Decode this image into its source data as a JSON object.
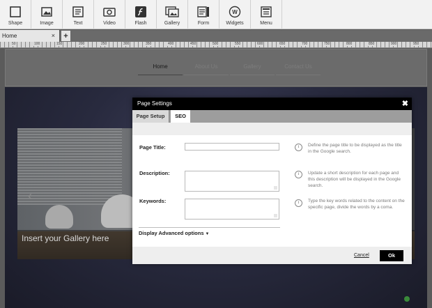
{
  "toolbar": {
    "items": [
      {
        "label": "Shape",
        "icon": "square-icon"
      },
      {
        "label": "Image",
        "icon": "image-icon"
      },
      {
        "label": "Text",
        "icon": "text-icon"
      },
      {
        "label": "Video",
        "icon": "video-icon"
      },
      {
        "label": "Flash",
        "icon": "flash-icon"
      },
      {
        "label": "Gallery",
        "icon": "gallery-icon"
      },
      {
        "label": "Form",
        "icon": "form-icon"
      },
      {
        "label": "Widgets",
        "icon": "widgets-icon"
      },
      {
        "label": "Menu",
        "icon": "menu-icon"
      }
    ]
  },
  "tabs": {
    "active": "Home",
    "close_glyph": "×",
    "add_glyph": "+"
  },
  "ruler": {
    "ticks": [
      "50",
      "100",
      "150",
      "200",
      "250",
      "300",
      "350",
      "400",
      "450",
      "500",
      "550",
      "600",
      "650",
      "700",
      "750",
      "800",
      "850",
      "900",
      "950"
    ]
  },
  "site": {
    "nav": [
      "Home",
      "About Us",
      "Gallery",
      "Contact Us"
    ],
    "gallery_caption": "Insert your Gallery here"
  },
  "modal": {
    "title": "Page Settings",
    "close_glyph": "✖",
    "tabs": [
      "Page Setup",
      "SEO"
    ],
    "active_tab": "SEO",
    "fields": {
      "page_title": {
        "label": "Page Title:",
        "value": "",
        "help": "Define the page title to be displayed as the title in the Google search."
      },
      "description": {
        "label": "Description:",
        "value": "",
        "help": "Update a short description for each page and this description will be displayed in the Google search."
      },
      "keywords": {
        "label": "Keywords:",
        "value": "",
        "help": "Type the key words related to the content on the specific page, divide the words by a coma."
      }
    },
    "info_glyph": "i",
    "advanced_label": "Display Advanced options",
    "advanced_caret": "▼",
    "cancel_label": "Cancel",
    "ok_label": "Ok"
  },
  "colors": {
    "modal_header": "#000000",
    "ok_button": "#000000",
    "overlay": "#5a5a5a"
  }
}
